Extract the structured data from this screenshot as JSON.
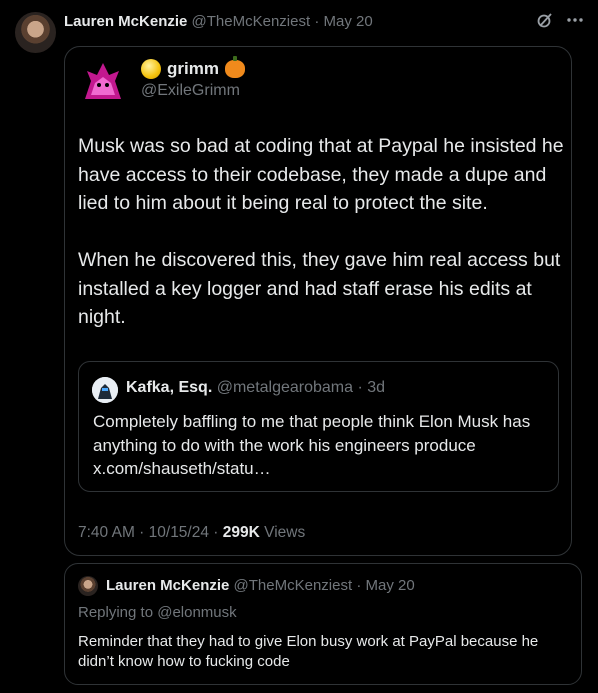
{
  "post": {
    "author_name": "Lauren McKenzie",
    "author_handle": "@TheMcKenziest",
    "sep": "·",
    "date": "May 20"
  },
  "embedded": {
    "author_name": "grimm",
    "author_handle": "@ExileGrimm",
    "body": "Musk was so bad at coding that at Paypal he insisted he have access to their codebase, they made a dupe and lied to him about it being real to protect the site.\n\nWhen he discovered this, they gave him real access but installed a key logger and had staff erase his edits at night.",
    "quote": {
      "author_name": "Kafka, Esq.",
      "author_handle": "@metalgearobama",
      "sep": "·",
      "age": "3d",
      "text": "Completely baffling to me that people think Elon Musk has anything to do with the work his engineers produce x.com/shauseth/statu…"
    },
    "time": "7:40 AM · 10/15/24 · ",
    "views_count": "299K",
    "views_label": " Views"
  },
  "reply": {
    "author_name": "Lauren McKenzie",
    "author_handle": "@TheMcKenziest",
    "sep": "·",
    "date": "May 20",
    "replying_to": "Replying to @elonmusk",
    "text": "Reminder that they had to give Elon busy work at PayPal because he didn’t know how to fucking code"
  },
  "icons": {
    "top_right": [
      "grok-icon",
      "more-icon"
    ],
    "author_badges": [
      "coin-icon",
      "pumpkin-icon"
    ]
  },
  "colors": {
    "background": "#000000",
    "text": "#e7e9ea",
    "muted": "#71767b",
    "border": "#2f3336"
  }
}
